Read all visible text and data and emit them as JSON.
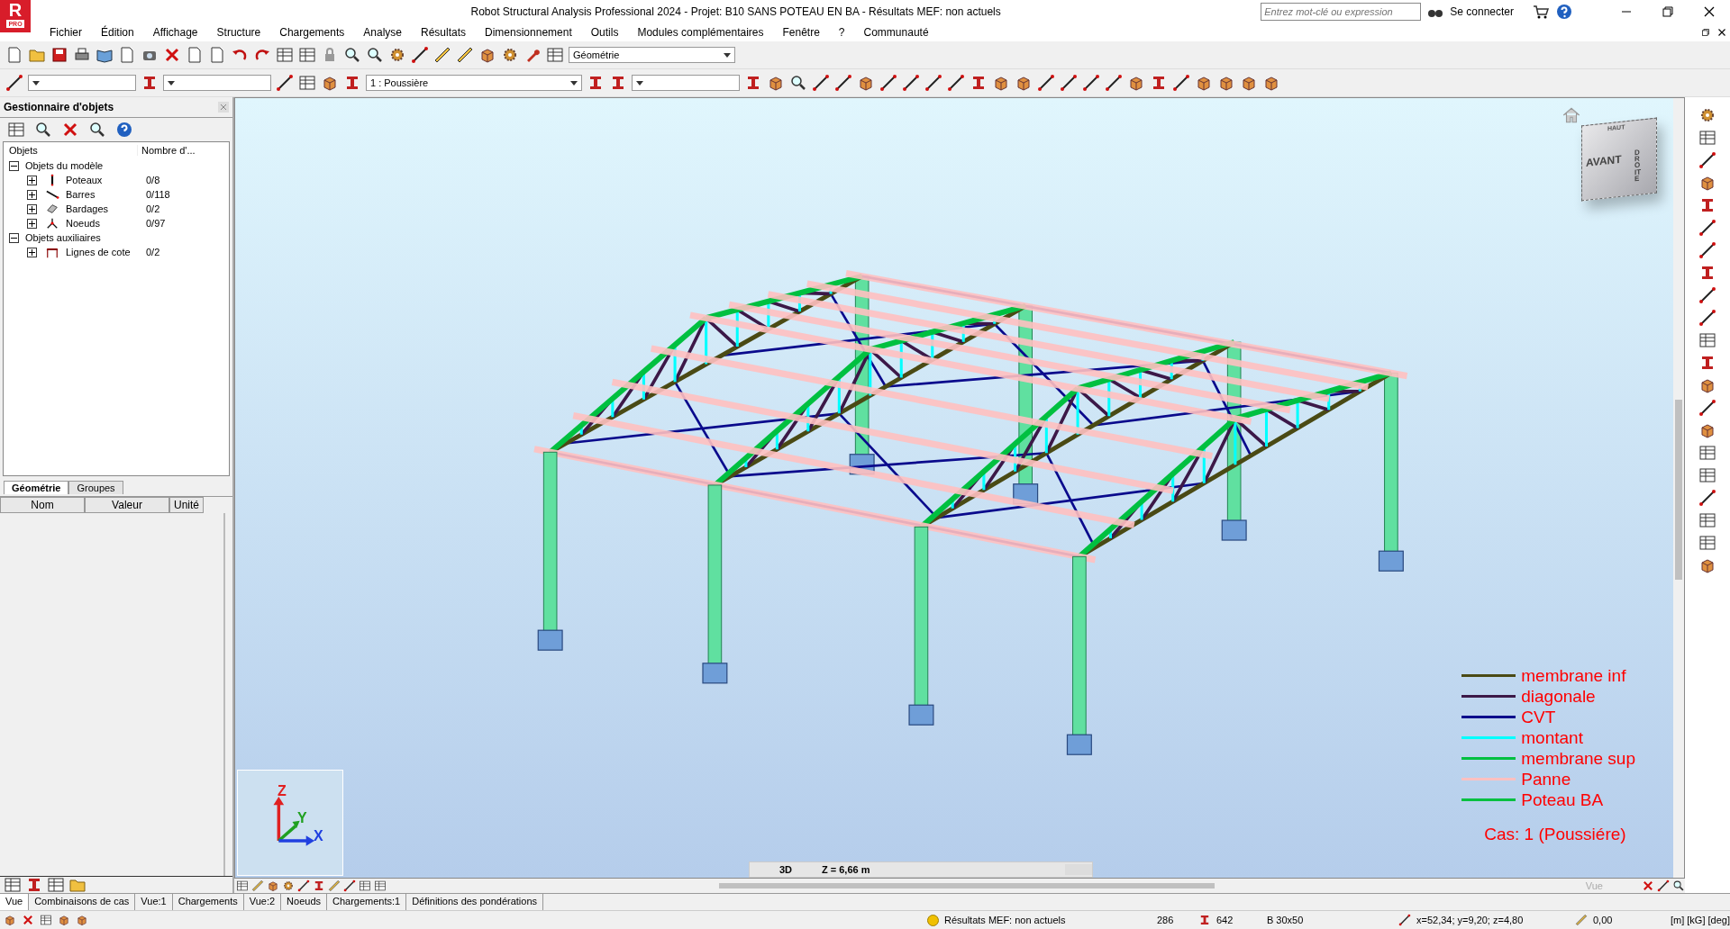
{
  "window": {
    "title": "Robot Structural Analysis Professional 2024 - Projet: B10 SANS POTEAU EN BA - Résultats MEF: non actuels",
    "logo_letter": "R",
    "logo_badge": "PRO"
  },
  "search": {
    "placeholder": "Entrez mot-clé ou expression"
  },
  "sign_in": "Se connecter",
  "menu": [
    "Fichier",
    "Édition",
    "Affichage",
    "Structure",
    "Chargements",
    "Analyse",
    "Résultats",
    "Dimensionnement",
    "Outils",
    "Modules complémentaires",
    "Fenêtre",
    "?",
    "Communauté"
  ],
  "toolbar": {
    "layout_combo": "Géométrie",
    "load_case_combo": "1 : Poussière"
  },
  "object_manager": {
    "title": "Gestionnaire d'objets",
    "columns": [
      "Objets",
      "Nombre d'..."
    ],
    "tree": [
      {
        "label": "Objets du modèle",
        "expanded": true,
        "children": [
          {
            "label": "Poteaux",
            "count": "0/8",
            "kind": "column",
            "expanded": false
          },
          {
            "label": "Barres",
            "count": "0/118",
            "kind": "bar",
            "expanded": false
          },
          {
            "label": "Bardages",
            "count": "0/2",
            "kind": "cladding",
            "expanded": false
          },
          {
            "label": "Noeuds",
            "count": "0/97",
            "kind": "node",
            "expanded": false
          }
        ]
      },
      {
        "label": "Objets auxiliaires",
        "expanded": true,
        "children": [
          {
            "label": "Lignes de cote",
            "count": "0/2",
            "kind": "dimension",
            "expanded": false
          }
        ]
      }
    ]
  },
  "panel_tabs": [
    {
      "label": "Géométrie",
      "selected": true
    },
    {
      "label": "Groupes",
      "selected": false
    }
  ],
  "properties": {
    "columns": [
      "Nom",
      "Valeur",
      "Unité"
    ]
  },
  "legend": [
    {
      "label": "membrane inf",
      "color": "#4a4a14"
    },
    {
      "label": "diagonale",
      "color": "#3c1848"
    },
    {
      "label": "CVT",
      "color": "#0a0a8c"
    },
    {
      "label": "montant",
      "color": "#00ffff"
    },
    {
      "label": "membrane sup",
      "color": "#00c040"
    },
    {
      "label": "Panne",
      "color": "#ffc0c0"
    },
    {
      "label": "Poteau BA",
      "color": "#00c040"
    }
  ],
  "load_case_label": "Cas: 1 (Poussiére)",
  "view_cube": {
    "front": "AVANT",
    "right": "DROITE",
    "top": "HAUT"
  },
  "axes": {
    "z": "Z",
    "y": "Y",
    "x": "X"
  },
  "view_bar": {
    "mode": "3D",
    "level": "Z = 6,66 m",
    "view_label": "Vue"
  },
  "bottom_tabs": [
    {
      "label": "Vue",
      "selected": true
    },
    {
      "label": "Combinaisons de cas",
      "selected": false
    },
    {
      "label": "Vue:1",
      "selected": false
    },
    {
      "label": "Chargements",
      "selected": false
    },
    {
      "label": "Vue:2",
      "selected": false
    },
    {
      "label": "Noeuds",
      "selected": false
    },
    {
      "label": "Chargements:1",
      "selected": false
    },
    {
      "label": "Définitions des pondérations",
      "selected": false
    }
  ],
  "status": {
    "message": "Résultats MEF: non actuels",
    "nodes": "286",
    "bars": "642",
    "section": "B 30x50",
    "coordinates": "x=52,34; y=9,20; z=4,80",
    "angle": "0,00",
    "units": "[m] [kG] [deg]"
  }
}
